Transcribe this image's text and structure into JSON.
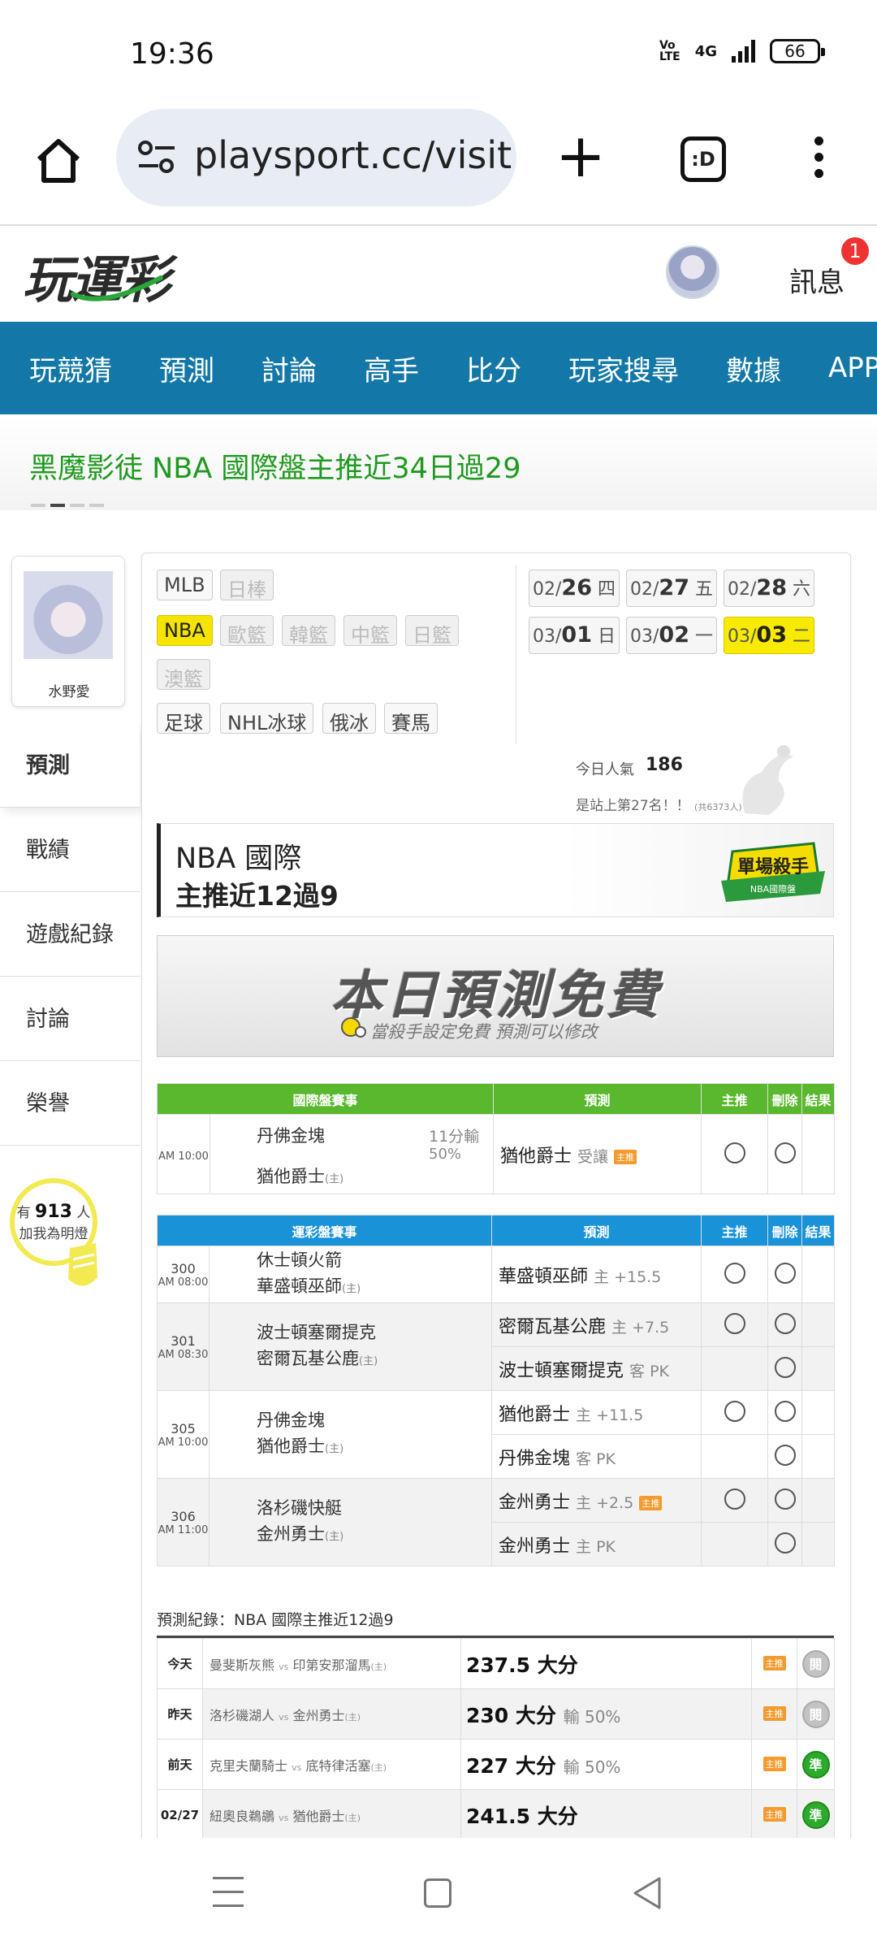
{
  "status_bar": {
    "time": "19:36",
    "network": "4G",
    "battery": "66"
  },
  "browser": {
    "url": "playsport.cc/visit",
    "tabs_label": ":D"
  },
  "site": {
    "logo": "玩運彩",
    "messages_label": "訊息",
    "messages_badge": "1"
  },
  "nav": {
    "items": [
      "玩競猜",
      "預測",
      "討論",
      "高手",
      "比分",
      "玩家搜尋",
      "數據",
      "APP"
    ]
  },
  "headline": "黑魔影徒 NBA 國際盤主推近34日過29",
  "sidebar": {
    "user_name": "水野愛",
    "menu": [
      "預測",
      "戰績",
      "遊戲紀錄",
      "討論",
      "榮譽"
    ],
    "fans_prefix": "有",
    "fans_count": "913",
    "fans_suffix": "人",
    "fans_caption": "加我為明燈"
  },
  "leagues": {
    "row1": [
      "MLB",
      "日棒"
    ],
    "row2": [
      "NBA",
      "歐籃",
      "韓籃",
      "中籃",
      "日籃"
    ],
    "row3": [
      "澳籃"
    ],
    "row4": [
      "足球",
      "NHL冰球",
      "俄冰",
      "賽馬"
    ]
  },
  "dates": [
    {
      "md": "02/",
      "d": "26",
      "wd": "四"
    },
    {
      "md": "02/",
      "d": "27",
      "wd": "五"
    },
    {
      "md": "02/",
      "d": "28",
      "wd": "六"
    },
    {
      "md": "03/",
      "d": "01",
      "wd": "日"
    },
    {
      "md": "03/",
      "d": "02",
      "wd": "一"
    },
    {
      "md": "03/",
      "d": "03",
      "wd": "二"
    }
  ],
  "popularity": {
    "label": "今日人氣",
    "value": "186",
    "rank_text": "是站上第27名！！",
    "rank_count": "(共6373人)"
  },
  "title": {
    "line1": "NBA 國際",
    "line2": "主推近12過9",
    "badge_line1": "單場殺手",
    "badge_line2": "NBA國際盤"
  },
  "free_banner": {
    "title": "本日預測免費",
    "subtitle": "當殺手設定免費  預測可以修改"
  },
  "intl_table": {
    "headers": [
      "國際盤賽事",
      "預測",
      "主推",
      "刪除",
      "結果"
    ],
    "rows": [
      {
        "time": "AM 10:00",
        "away": "丹佛金塊",
        "home": "猶他爵士",
        "home_mark": "(主)",
        "stat1": "11分輸",
        "stat2": "50%",
        "pick": "猶他爵士",
        "pick_note": "受讓",
        "tag": "主推"
      }
    ]
  },
  "lottery_table": {
    "headers": [
      "運彩盤賽事",
      "預測",
      "主推",
      "刪除",
      "結果"
    ],
    "games": [
      {
        "num": "300",
        "time": "AM 08:00",
        "away": "休士頓火箭",
        "home": "華盛頓巫師",
        "home_mark": "(主)",
        "picks": [
          {
            "team": "華盛頓巫師",
            "note": "主 +15.5",
            "tag": ""
          }
        ]
      },
      {
        "num": "301",
        "time": "AM 08:30",
        "away": "波士頓塞爾提克",
        "home": "密爾瓦基公鹿",
        "home_mark": "(主)",
        "picks": [
          {
            "team": "密爾瓦基公鹿",
            "note": "主 +7.5",
            "tag": ""
          },
          {
            "team": "波士頓塞爾提克",
            "note": "客 PK",
            "tag": ""
          }
        ]
      },
      {
        "num": "305",
        "time": "AM 10:00",
        "away": "丹佛金塊",
        "home": "猶他爵士",
        "home_mark": "(主)",
        "picks": [
          {
            "team": "猶他爵士",
            "note": "主 +11.5",
            "tag": ""
          },
          {
            "team": "丹佛金塊",
            "note": "客 PK",
            "tag": ""
          }
        ]
      },
      {
        "num": "306",
        "time": "AM 11:00",
        "away": "洛杉磯快艇",
        "home": "金州勇士",
        "home_mark": "(主)",
        "picks": [
          {
            "team": "金州勇士",
            "note": "主 +2.5",
            "tag": "主推"
          },
          {
            "team": "金州勇士",
            "note": "主 PK",
            "tag": ""
          }
        ]
      }
    ]
  },
  "records": {
    "title": "預測紀錄：NBA 國際主推近12過9",
    "rows": [
      {
        "day": "今天",
        "away": "曼斐斯灰熊",
        "home": "印第安那溜馬",
        "pick": "237.5 大分",
        "note": "",
        "tag": "主推",
        "result": "閱",
        "won": false
      },
      {
        "day": "昨天",
        "away": "洛杉磯湖人",
        "home": "金州勇士",
        "pick": "230 大分",
        "note": "輸 50%",
        "tag": "主推",
        "result": "閱",
        "won": false
      },
      {
        "day": "前天",
        "away": "克里夫蘭騎士",
        "home": "底特律活塞",
        "pick": "227 大分",
        "note": "輸 50%",
        "tag": "主推",
        "result": "準",
        "won": true
      },
      {
        "day": "02/27",
        "away": "紐奧良鵜鶘",
        "home": "猶他爵士",
        "pick": "241.5 大分",
        "note": "",
        "tag": "主推",
        "result": "準",
        "won": true
      }
    ],
    "vs": "vs",
    "home_mark": "(主)"
  }
}
